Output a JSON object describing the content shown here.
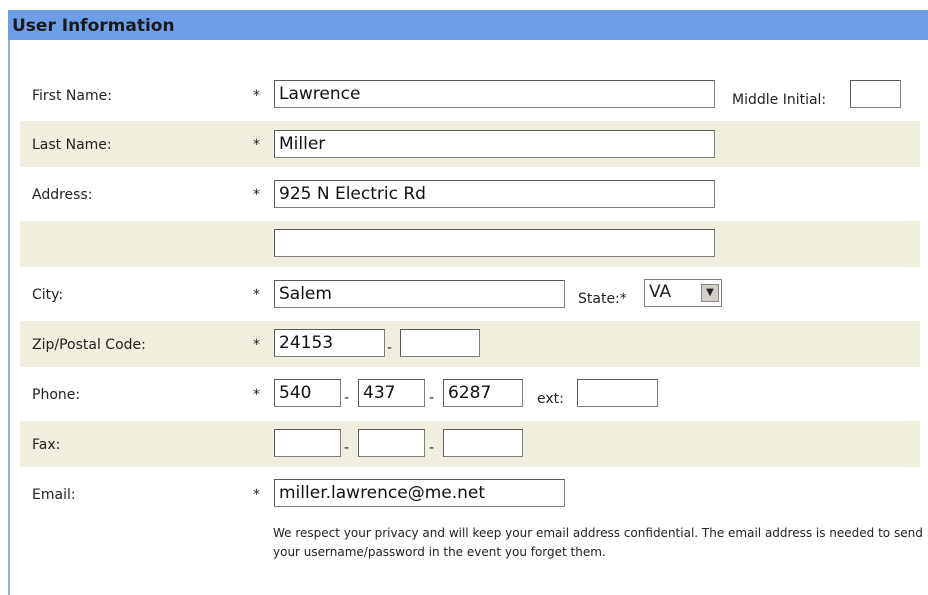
{
  "header": {
    "title": "User Information"
  },
  "required_marker": "*",
  "first_name": {
    "label": "First Name:",
    "value": "Lawrence"
  },
  "middle_initial": {
    "label": "Middle Initial:",
    "value": ""
  },
  "last_name": {
    "label": "Last Name:",
    "value": "Miller"
  },
  "address": {
    "label": "Address:",
    "line1": "925 N Electric Rd",
    "line2": ""
  },
  "city": {
    "label": "City:",
    "value": "Salem"
  },
  "state": {
    "label": "State:*",
    "value": "VA"
  },
  "zip": {
    "label": "Zip/Postal Code:",
    "value": "24153",
    "ext_value": ""
  },
  "phone": {
    "label": "Phone:",
    "area": "540",
    "prefix": "437",
    "line": "6287",
    "ext_label": "ext:",
    "ext_value": ""
  },
  "fax": {
    "label": "Fax:",
    "area": "",
    "prefix": "",
    "line": ""
  },
  "email": {
    "label": "Email:",
    "value": "miller.lawrence@me.net"
  },
  "privacy_note": "We respect your privacy and will keep your email address confidential. The email address is needed to send your username/password in the event you forget them.",
  "dash": "-"
}
